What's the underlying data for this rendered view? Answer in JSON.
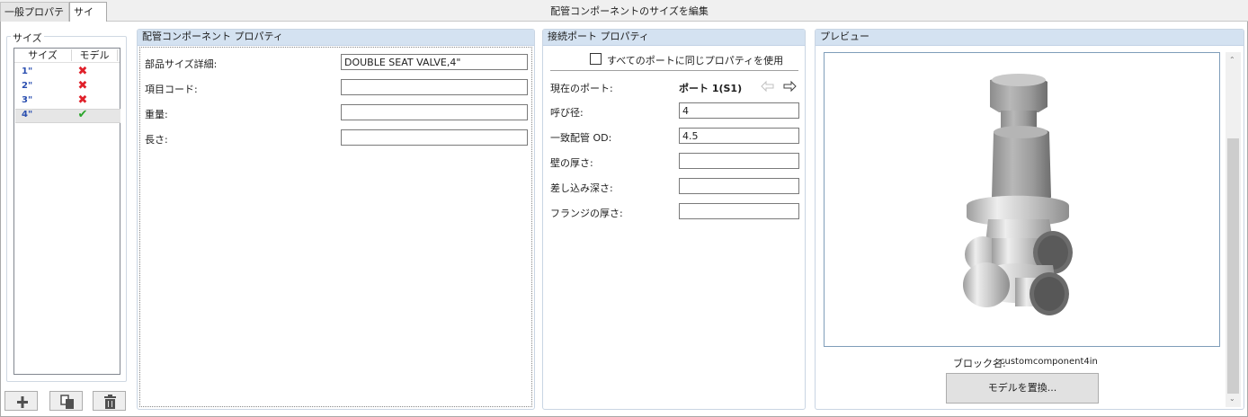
{
  "tabs": [
    {
      "label": "一般プロパティ",
      "active": false
    },
    {
      "label": "サイズ",
      "active": true
    }
  ],
  "window_title": "配管コンポーネントのサイズを編集",
  "sizes_group": {
    "title": "サイズ",
    "columns": [
      "サイズ",
      "モデル"
    ],
    "rows": [
      {
        "size": "1\"",
        "model": "✖",
        "has_model": false
      },
      {
        "size": "2\"",
        "model": "✖",
        "has_model": false
      },
      {
        "size": "3\"",
        "model": "✖",
        "has_model": false
      },
      {
        "size": "4\"",
        "model": "✔",
        "has_model": true,
        "selected": true
      }
    ],
    "toolbar": {
      "add_icon": "plus-icon",
      "copy_icon": "copy-icon",
      "delete_icon": "trash-icon"
    }
  },
  "component_properties": {
    "title": "配管コンポーネント プロパティ",
    "fields": [
      {
        "label": "部品サイズ詳細:",
        "value": "DOUBLE SEAT VALVE,4\""
      },
      {
        "label": "項目コード:",
        "value": ""
      },
      {
        "label": "重量:",
        "value": ""
      },
      {
        "label": "長さ:",
        "value": ""
      }
    ]
  },
  "port_properties": {
    "title": "接続ポート プロパティ",
    "same_props_label": "すべてのポートに同じプロパティを使用",
    "same_props_checked": false,
    "current_port_label": "現在のポート:",
    "current_port_value": "ポート 1(S1)",
    "prev_icon": "arrow-left-icon",
    "next_icon": "arrow-right-icon",
    "fields": [
      {
        "label": "呼び径:",
        "value": "4"
      },
      {
        "label": "一致配管 OD:",
        "value": "4.5"
      },
      {
        "label": "壁の厚さ:",
        "value": ""
      },
      {
        "label": "差し込み深さ:",
        "value": ""
      },
      {
        "label": "フランジの厚さ:",
        "value": ""
      }
    ]
  },
  "preview": {
    "title": "プレビュー",
    "block_name_label": "ブロック名:",
    "block_name_value": "customcomponent4in",
    "replace_button": "モデルを置換..."
  }
}
